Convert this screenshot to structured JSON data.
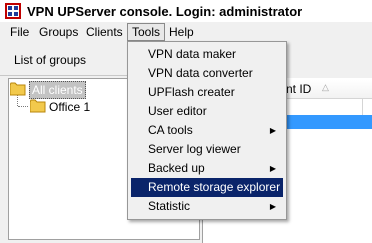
{
  "window": {
    "title": "VPN UPServer console. Login: administrator"
  },
  "menubar": {
    "items": [
      {
        "label": "File"
      },
      {
        "label": "Groups"
      },
      {
        "label": "Clients"
      },
      {
        "label": "Tools"
      },
      {
        "label": "Help"
      }
    ],
    "active": "Tools"
  },
  "left_panel": {
    "header": "List of groups"
  },
  "tree": {
    "root": {
      "label": "All clients"
    },
    "children": [
      {
        "label": "Office 1"
      }
    ]
  },
  "grid": {
    "column_header": "nt ID",
    "sort_indicator": "△"
  },
  "tools_menu": {
    "items": [
      {
        "label": "VPN data maker",
        "submenu": false
      },
      {
        "label": "VPN data converter",
        "submenu": false
      },
      {
        "label": "UPFlash creater",
        "submenu": false
      },
      {
        "label": "User editor",
        "submenu": false
      },
      {
        "label": "CA tools",
        "submenu": true,
        "arrow": "▶"
      },
      {
        "label": "Server log viewer",
        "submenu": false
      },
      {
        "label": "Backed up",
        "submenu": true,
        "arrow": "▶"
      },
      {
        "label": "Remote storage explorer",
        "submenu": false,
        "highlighted": true
      },
      {
        "label": "Statistic",
        "submenu": true,
        "arrow": "▶"
      }
    ]
  },
  "colors": {
    "highlight": "#0a246a",
    "selection": "#3399ff",
    "folder": "#f2c94c"
  }
}
